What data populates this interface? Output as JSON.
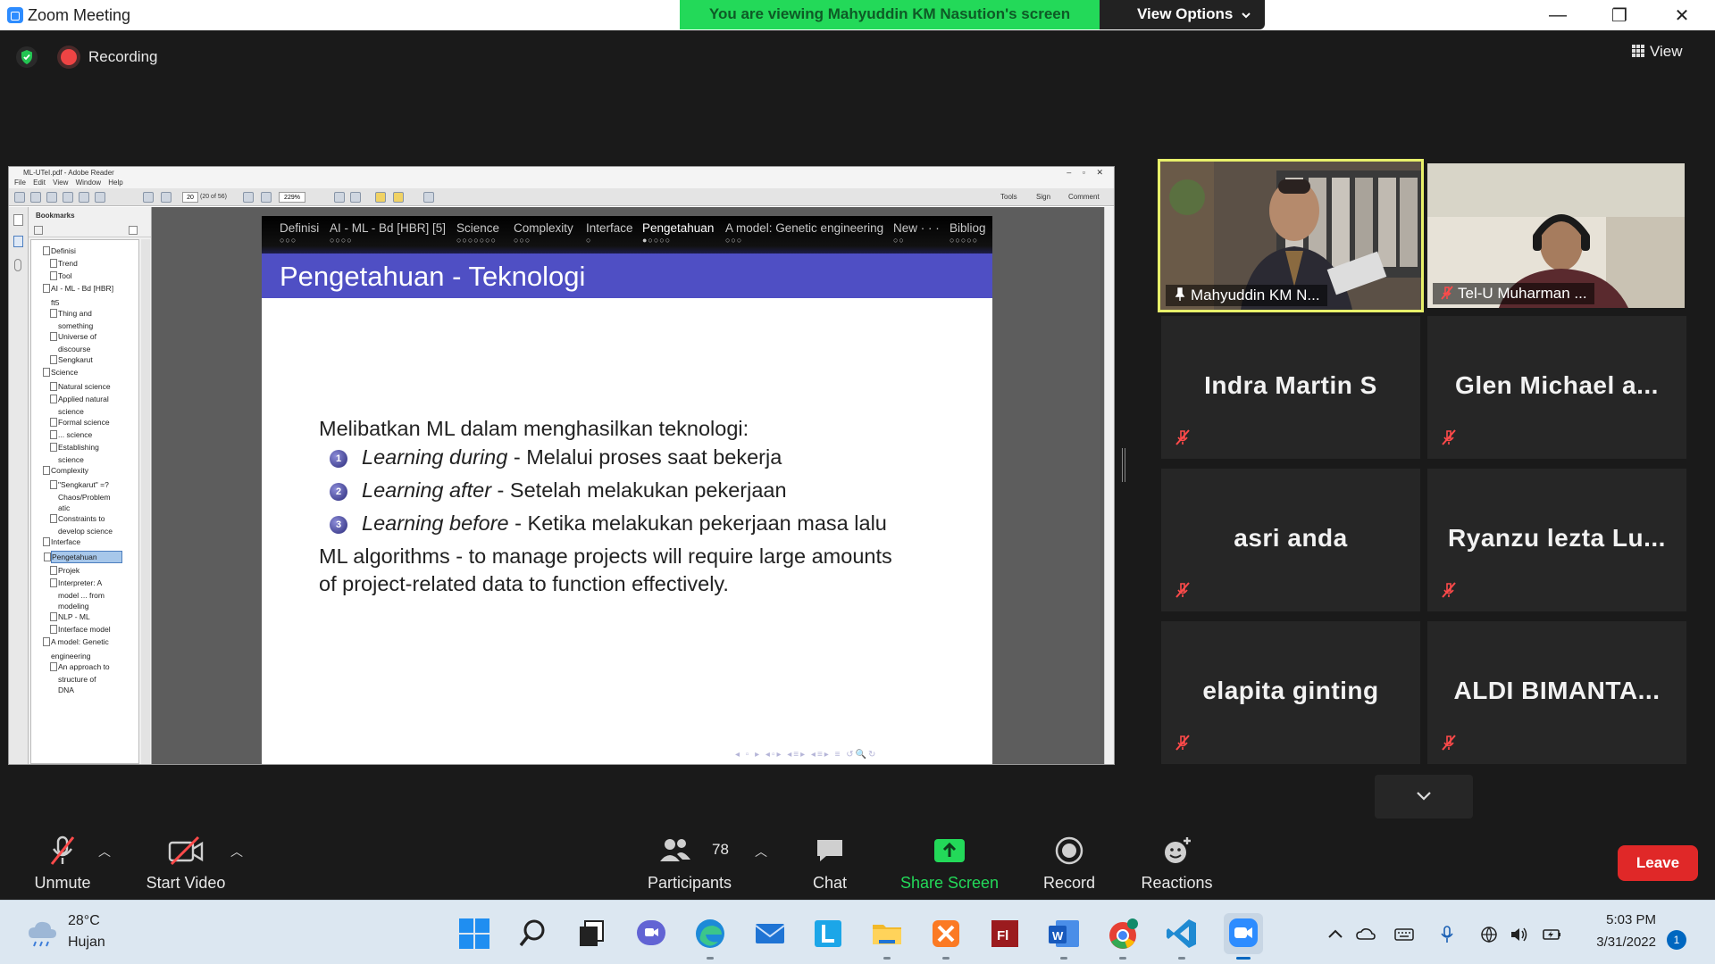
{
  "window": {
    "title": "Zoom Meeting",
    "banner": "You are viewing Mahyuddin KM Nasution's screen",
    "view_options": "View Options",
    "minimize": "—",
    "maximize": "❐",
    "close": "✕"
  },
  "meeting": {
    "recording_label": "Recording",
    "view_label": "View"
  },
  "shared_app": {
    "title": "ML-UTeI.pdf - Adobe Reader",
    "menu": [
      "File",
      "Edit",
      "View",
      "Window",
      "Help"
    ],
    "page_input": "20",
    "page_of": "(20 of 56)",
    "zoom": "229%",
    "right_tools": [
      "Tools",
      "Sign",
      "Comment"
    ],
    "bookmarks_title": "Bookmarks",
    "bookmarks": [
      {
        "label": "Definisi",
        "level": 0
      },
      {
        "label": "Trend",
        "level": 1
      },
      {
        "label": "Tool",
        "level": 1
      },
      {
        "label": "AI - ML - Bd [HBR]",
        "level": 0
      },
      {
        "label": "ft5",
        "level": 0,
        "cont": true
      },
      {
        "label": "Thing and",
        "level": 1
      },
      {
        "label": "something",
        "level": 1,
        "cont": true
      },
      {
        "label": "Universe of",
        "level": 1
      },
      {
        "label": "discourse",
        "level": 1,
        "cont": true
      },
      {
        "label": "Sengkarut",
        "level": 1
      },
      {
        "label": "Science",
        "level": 0
      },
      {
        "label": "Natural science",
        "level": 1
      },
      {
        "label": "Applied natural",
        "level": 1
      },
      {
        "label": "science",
        "level": 1,
        "cont": true
      },
      {
        "label": "Formal science",
        "level": 1
      },
      {
        "label": "... science",
        "level": 1
      },
      {
        "label": "Establishing",
        "level": 1
      },
      {
        "label": "science",
        "level": 1,
        "cont": true
      },
      {
        "label": "Complexity",
        "level": 0
      },
      {
        "label": "\"Sengkarut\" =?",
        "level": 1
      },
      {
        "label": "Chaos/Problem",
        "level": 1,
        "cont": true
      },
      {
        "label": "atic",
        "level": 1,
        "cont": true
      },
      {
        "label": "Constraints to",
        "level": 1
      },
      {
        "label": "develop science",
        "level": 1,
        "cont": true
      },
      {
        "label": "Interface",
        "level": 0
      },
      {
        "label": "Pengetahuan",
        "level": 0,
        "selected": true
      },
      {
        "label": "Projek",
        "level": 1
      },
      {
        "label": "Interpreter: A",
        "level": 1
      },
      {
        "label": "model ... from",
        "level": 1,
        "cont": true
      },
      {
        "label": "modeling",
        "level": 1,
        "cont": true
      },
      {
        "label": "NLP - ML",
        "level": 1
      },
      {
        "label": "Interface model",
        "level": 1
      },
      {
        "label": "A model: Genetic",
        "level": 0
      },
      {
        "label": "engineering",
        "level": 0,
        "cont": true
      },
      {
        "label": "An approach to",
        "level": 1
      },
      {
        "label": "structure of",
        "level": 1,
        "cont": true
      },
      {
        "label": "DNA",
        "level": 1,
        "cont": true
      }
    ]
  },
  "slide": {
    "nav": [
      {
        "label": "Definisi",
        "dots": "○○○"
      },
      {
        "label": "AI - ML - Bd [HBR] [5]",
        "dots": "○○○○"
      },
      {
        "label": "Science",
        "dots": "○○○○○○○"
      },
      {
        "label": "Complexity",
        "dots": "○○○"
      },
      {
        "label": "Interface",
        "dots": "○"
      },
      {
        "label": "Pengetahuan",
        "dots": "●○○○○",
        "active": true
      },
      {
        "label": "A model: Genetic engineering",
        "dots": "○○○"
      },
      {
        "label": "New · · ·",
        "dots": "○○"
      },
      {
        "label": "Bibliog",
        "dots": "○○○○○"
      }
    ],
    "title": "Pengetahuan - Teknologi",
    "intro": "Melibatkan ML dalam menghasilkan teknologi:",
    "items": [
      {
        "num": "1",
        "em": "Learning during",
        "rest": " - Melalui proses saat bekerja"
      },
      {
        "num": "2",
        "em": "Learning after",
        "rest": " - Setelah melakukan pekerjaan"
      },
      {
        "num": "3",
        "em": "Learning before",
        "rest": " - Ketika melakukan pekerjaan masa lalu"
      }
    ],
    "para_line1": "ML algorithms - to manage projects will require large amounts",
    "para_line2": "of project-related data to function effectively."
  },
  "participants_video": [
    {
      "name": "Mahyuddin KM N...",
      "active_speaker": true
    },
    {
      "name": "Tel-U Muharman ..."
    }
  ],
  "participants": [
    {
      "name": "Indra Martin S"
    },
    {
      "name": "Glen  Michael  a..."
    },
    {
      "name": "asri anda"
    },
    {
      "name": "Ryanzu  lezta  Lu..."
    },
    {
      "name": "elapita ginting"
    },
    {
      "name": "ALDI  BIMANTA..."
    }
  ],
  "controls": {
    "unmute": "Unmute",
    "start_video": "Start Video",
    "participants": "Participants",
    "participants_count": "78",
    "chat": "Chat",
    "share_screen": "Share Screen",
    "record": "Record",
    "reactions": "Reactions",
    "leave": "Leave"
  },
  "taskbar": {
    "temperature": "28°C",
    "weather": "Hujan",
    "time": "5:03 PM",
    "date": "3/31/2022",
    "notifications": "1"
  },
  "colors": {
    "banner_green": "#23d959",
    "share_green": "#23d959",
    "leave_red": "#e02828",
    "slide_title_bg": "#4f4fc4",
    "active_speaker_border": "#e8f06a"
  }
}
